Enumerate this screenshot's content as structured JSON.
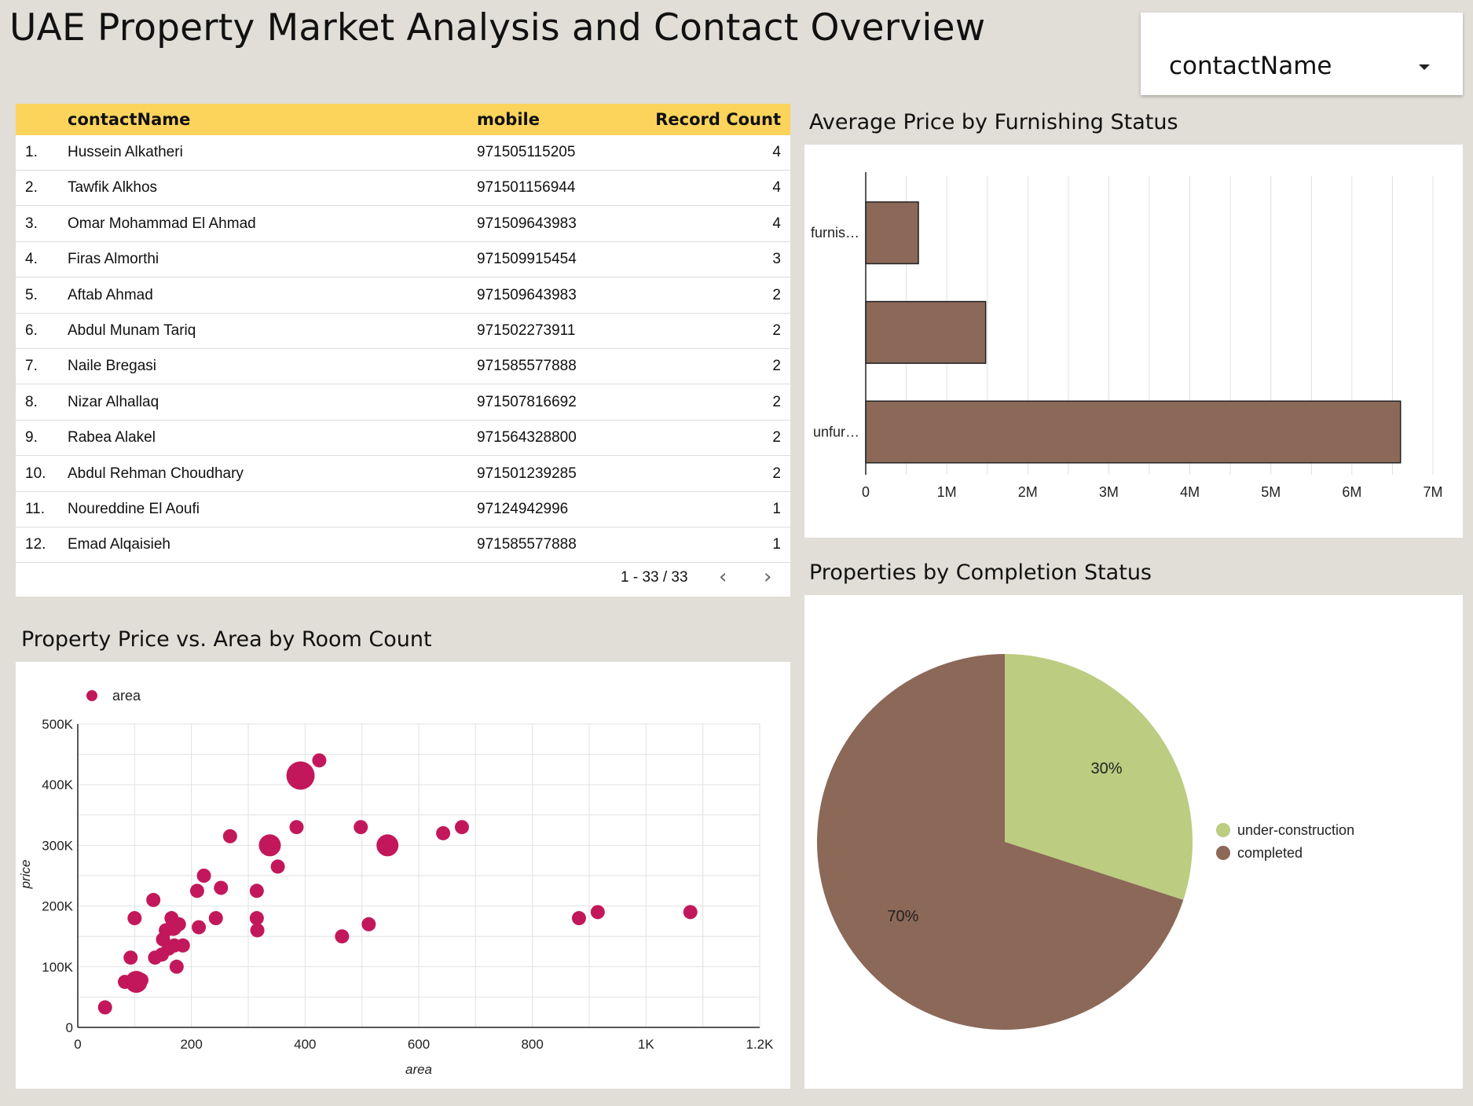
{
  "header": {
    "title": "UAE Property Market Analysis and Contact Overview",
    "filter_label": "contactName"
  },
  "table": {
    "columns": [
      "contactName",
      "mobile",
      "Record Count"
    ],
    "rows": [
      {
        "idx": "1.",
        "name": "Hussein Alkatheri",
        "mobile": "971505115205",
        "count": "4"
      },
      {
        "idx": "2.",
        "name": "Tawfik Alkhos",
        "mobile": "971501156944",
        "count": "4"
      },
      {
        "idx": "3.",
        "name": "Omar Mohammad El Ahmad",
        "mobile": "971509643983",
        "count": "4"
      },
      {
        "idx": "4.",
        "name": "Firas Almorthi",
        "mobile": "971509915454",
        "count": "3"
      },
      {
        "idx": "5.",
        "name": "Aftab Ahmad",
        "mobile": "971509643983",
        "count": "2"
      },
      {
        "idx": "6.",
        "name": "Abdul Munam Tariq",
        "mobile": "971502273911",
        "count": "2"
      },
      {
        "idx": "7.",
        "name": "Naile Bregasi",
        "mobile": "971585577888",
        "count": "2"
      },
      {
        "idx": "8.",
        "name": "Nizar Alhallaq",
        "mobile": "971507816692",
        "count": "2"
      },
      {
        "idx": "9.",
        "name": "Rabea Alakel",
        "mobile": "971564328800",
        "count": "2"
      },
      {
        "idx": "10.",
        "name": "Abdul Rehman Choudhary",
        "mobile": "971501239285",
        "count": "2"
      },
      {
        "idx": "11.",
        "name": "Noureddine El Aoufi",
        "mobile": "97124942996",
        "count": "1"
      },
      {
        "idx": "12.",
        "name": "Emad Alqaisieh",
        "mobile": "971585577888",
        "count": "1"
      }
    ],
    "pagination": "1 - 33 / 33",
    "prev_icon": "chevron-left-icon",
    "next_icon": "chevron-right-icon"
  },
  "colors": {
    "table_header": "#fcd45c",
    "bar": "#8b6858",
    "scatter": "#c2185b",
    "pie_completed": "#8b6858",
    "pie_under_construction": "#bccc80",
    "background": "#e0ded6"
  },
  "chart_data": [
    {
      "type": "bar",
      "orientation": "horizontal",
      "title": "Average Price by Furnishing Status",
      "categories": [
        "furnis…",
        "",
        "unfur…"
      ],
      "values": [
        650000,
        1480000,
        6600000
      ],
      "xlim": [
        0,
        7000000
      ],
      "x_ticks": [
        "0",
        "1M",
        "2M",
        "3M",
        "4M",
        "5M",
        "6M",
        "7M"
      ],
      "grid": true
    },
    {
      "type": "scatter",
      "title": "Property Price vs. Area by Room Count",
      "xlabel": "area",
      "ylabel": "price",
      "legend": [
        "area"
      ],
      "legend_position": "top-left",
      "xlim": [
        0,
        1200
      ],
      "ylim": [
        0,
        500000
      ],
      "x_ticks": [
        "0",
        "200",
        "400",
        "600",
        "800",
        "1K",
        "1.2K"
      ],
      "y_ticks": [
        "0",
        "100K",
        "200K",
        "300K",
        "400K",
        "500K"
      ],
      "grid": true,
      "points": [
        {
          "x": 48,
          "y": 33000,
          "r": 1
        },
        {
          "x": 83,
          "y": 75000,
          "r": 1
        },
        {
          "x": 93,
          "y": 115000,
          "r": 1
        },
        {
          "x": 100,
          "y": 180000,
          "r": 1
        },
        {
          "x": 103,
          "y": 75000,
          "r": 3
        },
        {
          "x": 112,
          "y": 78000,
          "r": 1
        },
        {
          "x": 133,
          "y": 210000,
          "r": 1
        },
        {
          "x": 136,
          "y": 115000,
          "r": 1
        },
        {
          "x": 148,
          "y": 120000,
          "r": 1
        },
        {
          "x": 150,
          "y": 145000,
          "r": 1
        },
        {
          "x": 155,
          "y": 160000,
          "r": 1
        },
        {
          "x": 160,
          "y": 130000,
          "r": 1
        },
        {
          "x": 165,
          "y": 180000,
          "r": 1
        },
        {
          "x": 168,
          "y": 165000,
          "r": 2
        },
        {
          "x": 170,
          "y": 135000,
          "r": 1
        },
        {
          "x": 174,
          "y": 100000,
          "r": 1
        },
        {
          "x": 178,
          "y": 170000,
          "r": 1
        },
        {
          "x": 185,
          "y": 135000,
          "r": 1
        },
        {
          "x": 210,
          "y": 225000,
          "r": 1
        },
        {
          "x": 213,
          "y": 165000,
          "r": 1
        },
        {
          "x": 222,
          "y": 250000,
          "r": 1
        },
        {
          "x": 243,
          "y": 180000,
          "r": 1
        },
        {
          "x": 252,
          "y": 230000,
          "r": 1
        },
        {
          "x": 268,
          "y": 315000,
          "r": 1
        },
        {
          "x": 315,
          "y": 225000,
          "r": 1
        },
        {
          "x": 315,
          "y": 180000,
          "r": 1
        },
        {
          "x": 316,
          "y": 160000,
          "r": 1
        },
        {
          "x": 338,
          "y": 300000,
          "r": 3
        },
        {
          "x": 352,
          "y": 265000,
          "r": 1
        },
        {
          "x": 385,
          "y": 330000,
          "r": 1
        },
        {
          "x": 392,
          "y": 415000,
          "r": 4
        },
        {
          "x": 425,
          "y": 440000,
          "r": 1
        },
        {
          "x": 465,
          "y": 150000,
          "r": 1
        },
        {
          "x": 498,
          "y": 330000,
          "r": 1
        },
        {
          "x": 512,
          "y": 170000,
          "r": 1
        },
        {
          "x": 545,
          "y": 300000,
          "r": 3
        },
        {
          "x": 643,
          "y": 320000,
          "r": 1
        },
        {
          "x": 676,
          "y": 330000,
          "r": 1
        },
        {
          "x": 882,
          "y": 180000,
          "r": 1
        },
        {
          "x": 915,
          "y": 190000,
          "r": 1
        },
        {
          "x": 1078,
          "y": 190000,
          "r": 1
        }
      ]
    },
    {
      "type": "pie",
      "title": "Properties by Completion Status",
      "legend_position": "right",
      "slices": [
        {
          "label": "under-construction",
          "value": 30,
          "display": "30%",
          "color": "#bccc80"
        },
        {
          "label": "completed",
          "value": 70,
          "display": "70%",
          "color": "#8b6858"
        }
      ]
    }
  ]
}
